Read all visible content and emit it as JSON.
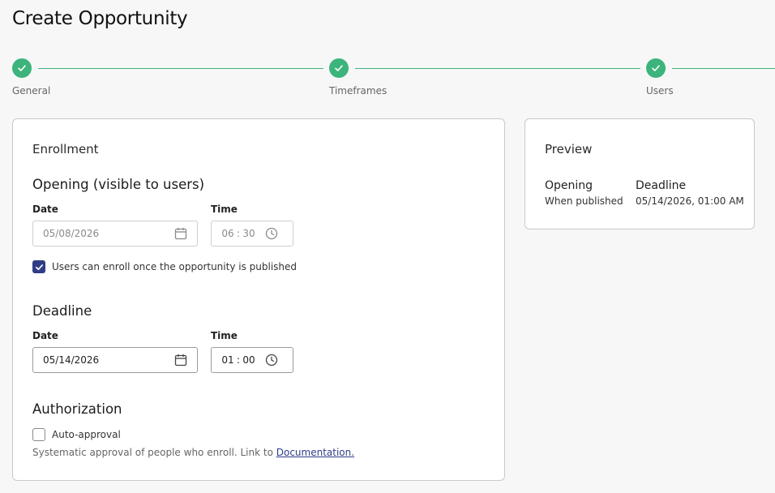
{
  "page": {
    "title": "Create Opportunity"
  },
  "stepper": {
    "steps": [
      {
        "label": "General",
        "status": "complete"
      },
      {
        "label": "Timeframes",
        "status": "complete"
      },
      {
        "label": "Users",
        "status": "complete"
      }
    ],
    "color": "#3cb47c"
  },
  "enrollment": {
    "heading": "Enrollment",
    "opening": {
      "heading": "Opening (visible to users)",
      "date_label": "Date",
      "date_value": "05/08/2026",
      "time_label": "Time",
      "time_hour": "06",
      "time_minute": "30",
      "time_separator": ":",
      "disabled": true,
      "checkbox_label": "Users can enroll once the opportunity is published",
      "checkbox_checked": true
    },
    "deadline": {
      "heading": "Deadline",
      "date_label": "Date",
      "date_value": "05/14/2026",
      "time_label": "Time",
      "time_hour": "01",
      "time_minute": "00",
      "time_separator": ":"
    }
  },
  "authorization": {
    "heading": "Authorization",
    "checkbox_label": "Auto-approval",
    "checkbox_checked": false,
    "help_text": "Systematic approval of people who enroll. Link to ",
    "help_link": "Documentation."
  },
  "preview": {
    "heading": "Preview",
    "opening_label": "Opening",
    "opening_value": "When published",
    "deadline_label": "Deadline",
    "deadline_value": "05/14/2026, 01:00 AM"
  },
  "icons": {
    "step_check": "check-icon",
    "calendar": "calendar-icon",
    "clock": "clock-icon",
    "checkbox_check": "check-icon"
  },
  "colors": {
    "accent": "#3cb47c",
    "checkbox": "#2e3d85",
    "link": "#2e3d85"
  }
}
